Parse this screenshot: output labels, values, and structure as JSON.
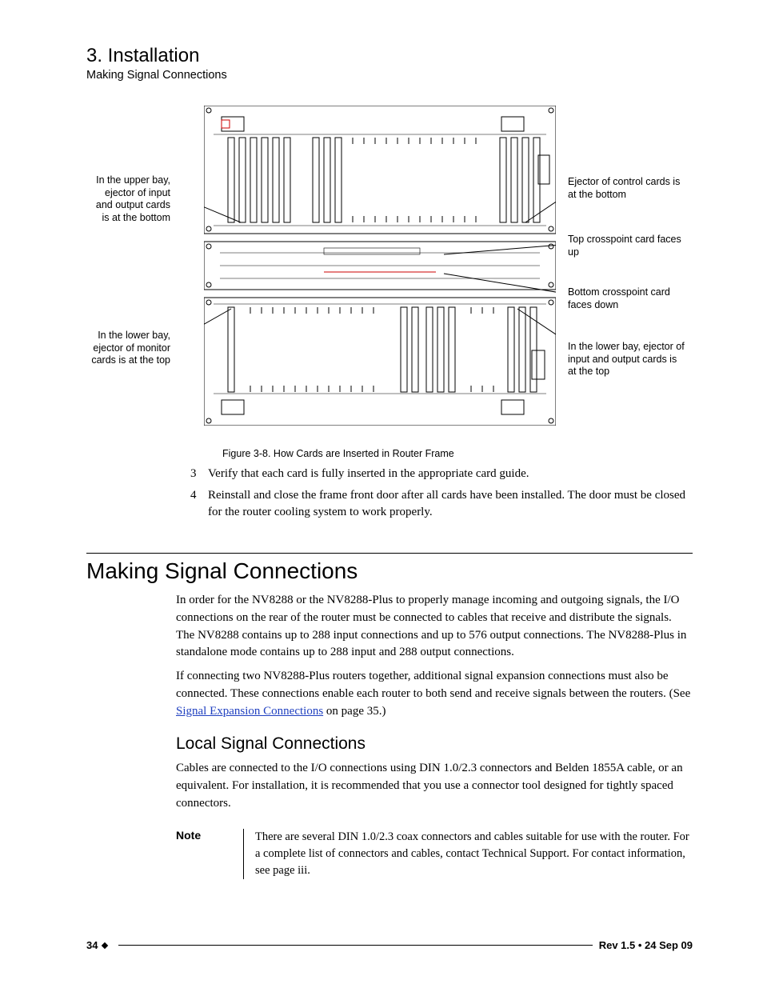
{
  "header": {
    "chapter": "3. Installation",
    "section": "Making Signal Connections"
  },
  "figure": {
    "labels": {
      "upperLeft": "In the upper bay, ejector of input and output cards is at the bottom",
      "lowerLeft": "In the lower bay, ejector of monitor cards is at the top",
      "controlCards": "Ejector of control cards is at the bottom",
      "topCrosspoint": "Top crosspoint card faces up",
      "bottomCrosspoint": "Bottom crosspoint card faces down",
      "lowerRight": "In the lower bay, ejector of input and output cards is at the top"
    },
    "caption": "Figure 3-8. How Cards are Inserted in Router Frame"
  },
  "steps": {
    "s3": {
      "num": "3",
      "text": "Verify that each card is fully inserted in the appropriate card guide."
    },
    "s4": {
      "num": "4",
      "text": "Reinstall and close the frame front door after all cards have been installed. The door must be closed for the router cooling system to work properly."
    }
  },
  "body": {
    "h1": "Making Signal Connections",
    "p1": "In order for the NV8288 or the NV8288-Plus to properly manage incoming and outgoing signals, the I/O connections on the rear of the router must be connected to cables that receive and distribute the signals. The NV8288 contains up to 288 input connections and up to 576 output connections. The NV8288-Plus in standalone mode contains up to 288 input and 288 output connections.",
    "p2a": "If connecting two NV8288-Plus routers together, additional signal expansion connections must also be connected. These connections enable each router to both send and receive signals between the routers. (See ",
    "p2link": "Signal Expansion Connections",
    "p2b": " on page 35.)",
    "h2": "Local Signal Connections",
    "p3": "Cables are connected to the I/O connections using DIN 1.0/2.3 connectors and Belden 1855A cable, or an equivalent. For installation, it is recommended that you use a connector tool designed for tightly spaced connectors.",
    "noteLabel": "Note",
    "noteText": "There are several DIN 1.0/2.3 coax connectors and cables suitable for use with the router. For a complete list of connectors and cables, contact Technical Support. For contact information, see page iii."
  },
  "footer": {
    "pageNum": "34",
    "rev": "Rev 1.5 • 24 Sep 09"
  }
}
